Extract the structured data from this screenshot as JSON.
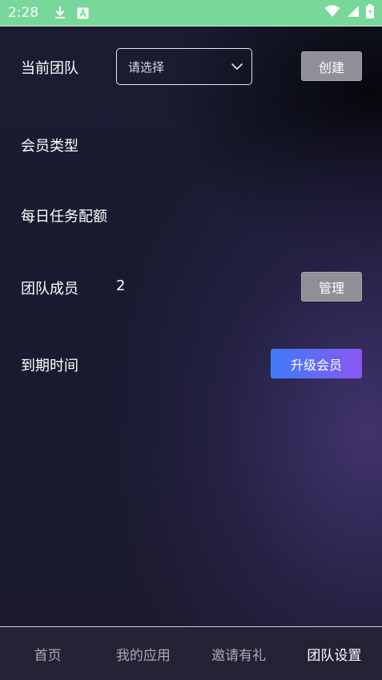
{
  "status_bar": {
    "time": "2:28",
    "icons": [
      "download-icon",
      "a-badge-icon",
      "wifi-icon",
      "signal-icon",
      "battery-icon"
    ]
  },
  "form": {
    "current_team": {
      "label": "当前团队",
      "select_placeholder": "请选择",
      "button": "创建"
    },
    "member_type": {
      "label": "会员类型"
    },
    "daily_quota": {
      "label": "每日任务配额"
    },
    "team_members": {
      "label": "团队成员",
      "value": "2",
      "button": "管理"
    },
    "expiry": {
      "label": "到期时间",
      "button": "升级会员"
    }
  },
  "bottom_nav": {
    "items": [
      {
        "label": "首页",
        "active": false
      },
      {
        "label": "我的应用",
        "active": false
      },
      {
        "label": "邀请有礼",
        "active": false
      },
      {
        "label": "团队设置",
        "active": true
      }
    ]
  },
  "colors": {
    "status_bar": "#77d89a",
    "accent_gradient_start": "#3d7cf7",
    "accent_gradient_end": "#8a58f2",
    "button_gray": "#8f9097"
  }
}
